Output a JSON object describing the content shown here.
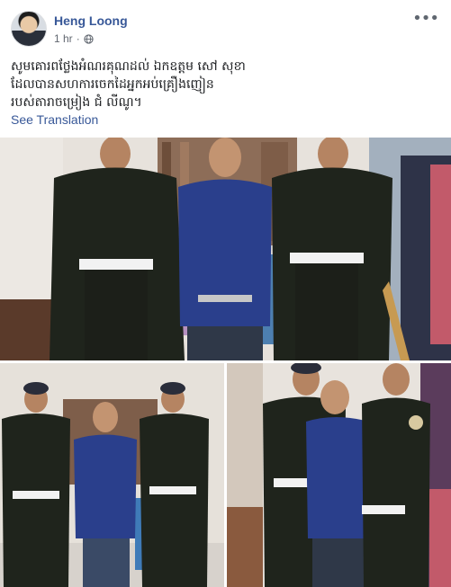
{
  "post": {
    "author_name": "Heng Loong",
    "timestamp": "1 hr",
    "separator": "·",
    "privacy_icon": "globe-icon",
    "more_icon": "more-options-icon",
    "caption": "សូមគោរពថ្លែងអំណរគុណដល់ ឯកឧត្តម សៅ សុខា\nដែលបានសហការចេកដៃអ្នកអប់គ្រឿងញៀន\nរបស់តារាចម្រៀង ជំ លីណូ។",
    "see_translation": "See Translation"
  },
  "colors": {
    "link": "#385898",
    "meta": "#616770",
    "uniform": "#1f241c"
  }
}
